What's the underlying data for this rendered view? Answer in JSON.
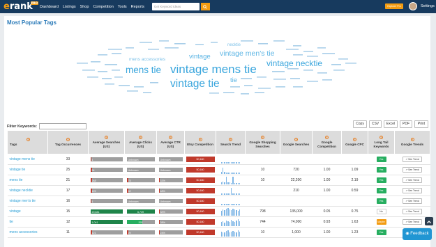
{
  "topbar": {
    "logo": "erank",
    "logo_badge": "PRO",
    "nav": [
      "Dashboard",
      "Listings",
      "Shop",
      "Competition",
      "Tools",
      "Reports"
    ],
    "search_placeholder": "Get Keyword Ideas",
    "upgrade": "Explorer Pro",
    "settings": "Settings"
  },
  "page_title": "Most Popular Tags",
  "tag_cloud": [
    {
      "text": "vintage mens tie",
      "size": 17
    },
    {
      "text": "mens tie",
      "size": 13
    },
    {
      "text": "vintage tie",
      "size": 15
    },
    {
      "text": "vintage necktie",
      "size": 11
    },
    {
      "text": "vintage men's tie",
      "size": 10
    },
    {
      "text": "vintage",
      "size": 9
    },
    {
      "text": "tie",
      "size": 9
    },
    {
      "text": "mens accessories",
      "size": 6
    },
    {
      "text": "necktie",
      "size": 6
    }
  ],
  "filter": {
    "label": "Filter Keywords:",
    "value": ""
  },
  "export_buttons": [
    "Copy",
    "CSV",
    "Excel",
    "PDF",
    "Print"
  ],
  "table": {
    "headers": [
      "Tags",
      "Tag Occurrences",
      "Average Searches (US)",
      "Average Clicks (US)",
      "Average CTR (US)",
      "Etsy Competition",
      "Search Trend",
      "Google Shopping Searches",
      "Google Searches",
      "Google Competition",
      "Google CPC",
      "Long Tail Keywords",
      "Google Trends"
    ],
    "rows": [
      {
        "tag": "vintage mens tie",
        "occ": "33",
        "searches": "1",
        "s_pct": 2,
        "clicks": "Unknown",
        "c_pct": 0,
        "ctr": "Unknown",
        "etsy": "50,180",
        "trend": [
          1,
          1,
          1,
          1,
          1,
          1,
          1,
          1,
          1,
          1,
          1,
          1
        ],
        "gshop": "",
        "gsearch": "",
        "gcomp": "",
        "cpc": "",
        "lt": "Yes",
        "gt": "See Trend"
      },
      {
        "tag": "vintage tie",
        "occ": "25",
        "searches": "94",
        "s_pct": 5,
        "clicks": "Unknown",
        "c_pct": 0,
        "ctr": "Unknown",
        "etsy": "50,180",
        "trend": [
          2,
          8,
          2,
          1,
          1,
          1,
          1,
          1,
          1,
          1,
          1,
          1
        ],
        "gshop": "10",
        "gsearch": "720",
        "gcomp": "1.00",
        "cpc": "1.09",
        "lt": "Yes",
        "gt": "See Trend"
      },
      {
        "tag": "mens tie",
        "occ": "21",
        "searches": "248",
        "s_pct": 6,
        "clicks": "78",
        "c_pct": 6,
        "ctr": "31%",
        "etsy": "50,180",
        "trend": [
          2,
          3,
          2,
          10,
          2,
          2,
          1,
          10,
          1,
          1,
          1,
          1
        ],
        "gshop": "10",
        "gsearch": "22,200",
        "gcomp": "1.00",
        "cpc": "2.19",
        "lt": "Yes",
        "gt": "See Trend"
      },
      {
        "tag": "vintage necktie",
        "occ": "17",
        "searches": "129",
        "s_pct": 5,
        "clicks": "62",
        "c_pct": 5,
        "ctr": "48%",
        "etsy": "50,180",
        "trend": [
          1,
          1,
          1,
          1,
          1,
          1,
          9,
          1,
          1,
          1,
          1,
          1
        ],
        "gshop": "",
        "gsearch": "210",
        "gcomp": "1.00",
        "cpc": "0.59",
        "lt": "Yes",
        "gt": "See Trend"
      },
      {
        "tag": "vintage men's tie",
        "occ": "16",
        "searches": "1",
        "s_pct": 2,
        "clicks": "Unknown",
        "c_pct": 0,
        "ctr": "Unknown",
        "etsy": "50,180",
        "trend": [
          1,
          1,
          1,
          1,
          1,
          1,
          1,
          1,
          1,
          1,
          1,
          1
        ],
        "gshop": "",
        "gsearch": "",
        "gcomp": "",
        "cpc": "",
        "lt": "Yes",
        "gt": "See Trend"
      },
      {
        "tag": "vintage",
        "occ": "15",
        "searches": "20,841",
        "s_pct": 100,
        "clicks": "6,749",
        "c_pct": 100,
        "ctr": "32%",
        "etsy": "50,180",
        "trend": [
          6,
          8,
          7,
          9,
          10,
          8,
          7,
          9,
          8,
          7,
          6,
          8
        ],
        "gshop": "798",
        "gsearch": "135,000",
        "gcomp": "0.05",
        "cpc": "0.75",
        "lt": "No",
        "gt": "See Trend"
      },
      {
        "tag": "tie",
        "occ": "12",
        "searches": "1,041",
        "s_pct": 100,
        "clicks": "293",
        "c_pct": 55,
        "ctr": "28%",
        "etsy": "50,180",
        "trend": [
          5,
          6,
          4,
          7,
          6,
          5,
          8,
          6,
          5,
          7,
          9,
          6
        ],
        "gshop": "744",
        "gsearch": "74,000",
        "gcomp": "0.93",
        "cpc": "1.63",
        "lt": "Maybe",
        "gt": "See Trend"
      },
      {
        "tag": "mens accessories",
        "occ": "11",
        "searches": "121",
        "s_pct": 5,
        "clicks": "29",
        "c_pct": 5,
        "ctr": "24%",
        "etsy": "50,180",
        "trend": [
          6,
          5,
          5,
          7,
          8,
          5,
          6,
          7,
          6,
          5,
          8,
          6
        ],
        "gshop": "10",
        "gsearch": "1,000",
        "gcomp": "1.00",
        "cpc": "1.23",
        "lt": "Yes",
        "gt": "See Trend"
      }
    ]
  },
  "feedback": "Feedback",
  "colors": {
    "topbar": "#173a5e",
    "accent": "#f39c12",
    "link": "#2a9fd6",
    "cloud": "#4fa8d8",
    "green": "#1e8449",
    "red": "#c0392b"
  }
}
